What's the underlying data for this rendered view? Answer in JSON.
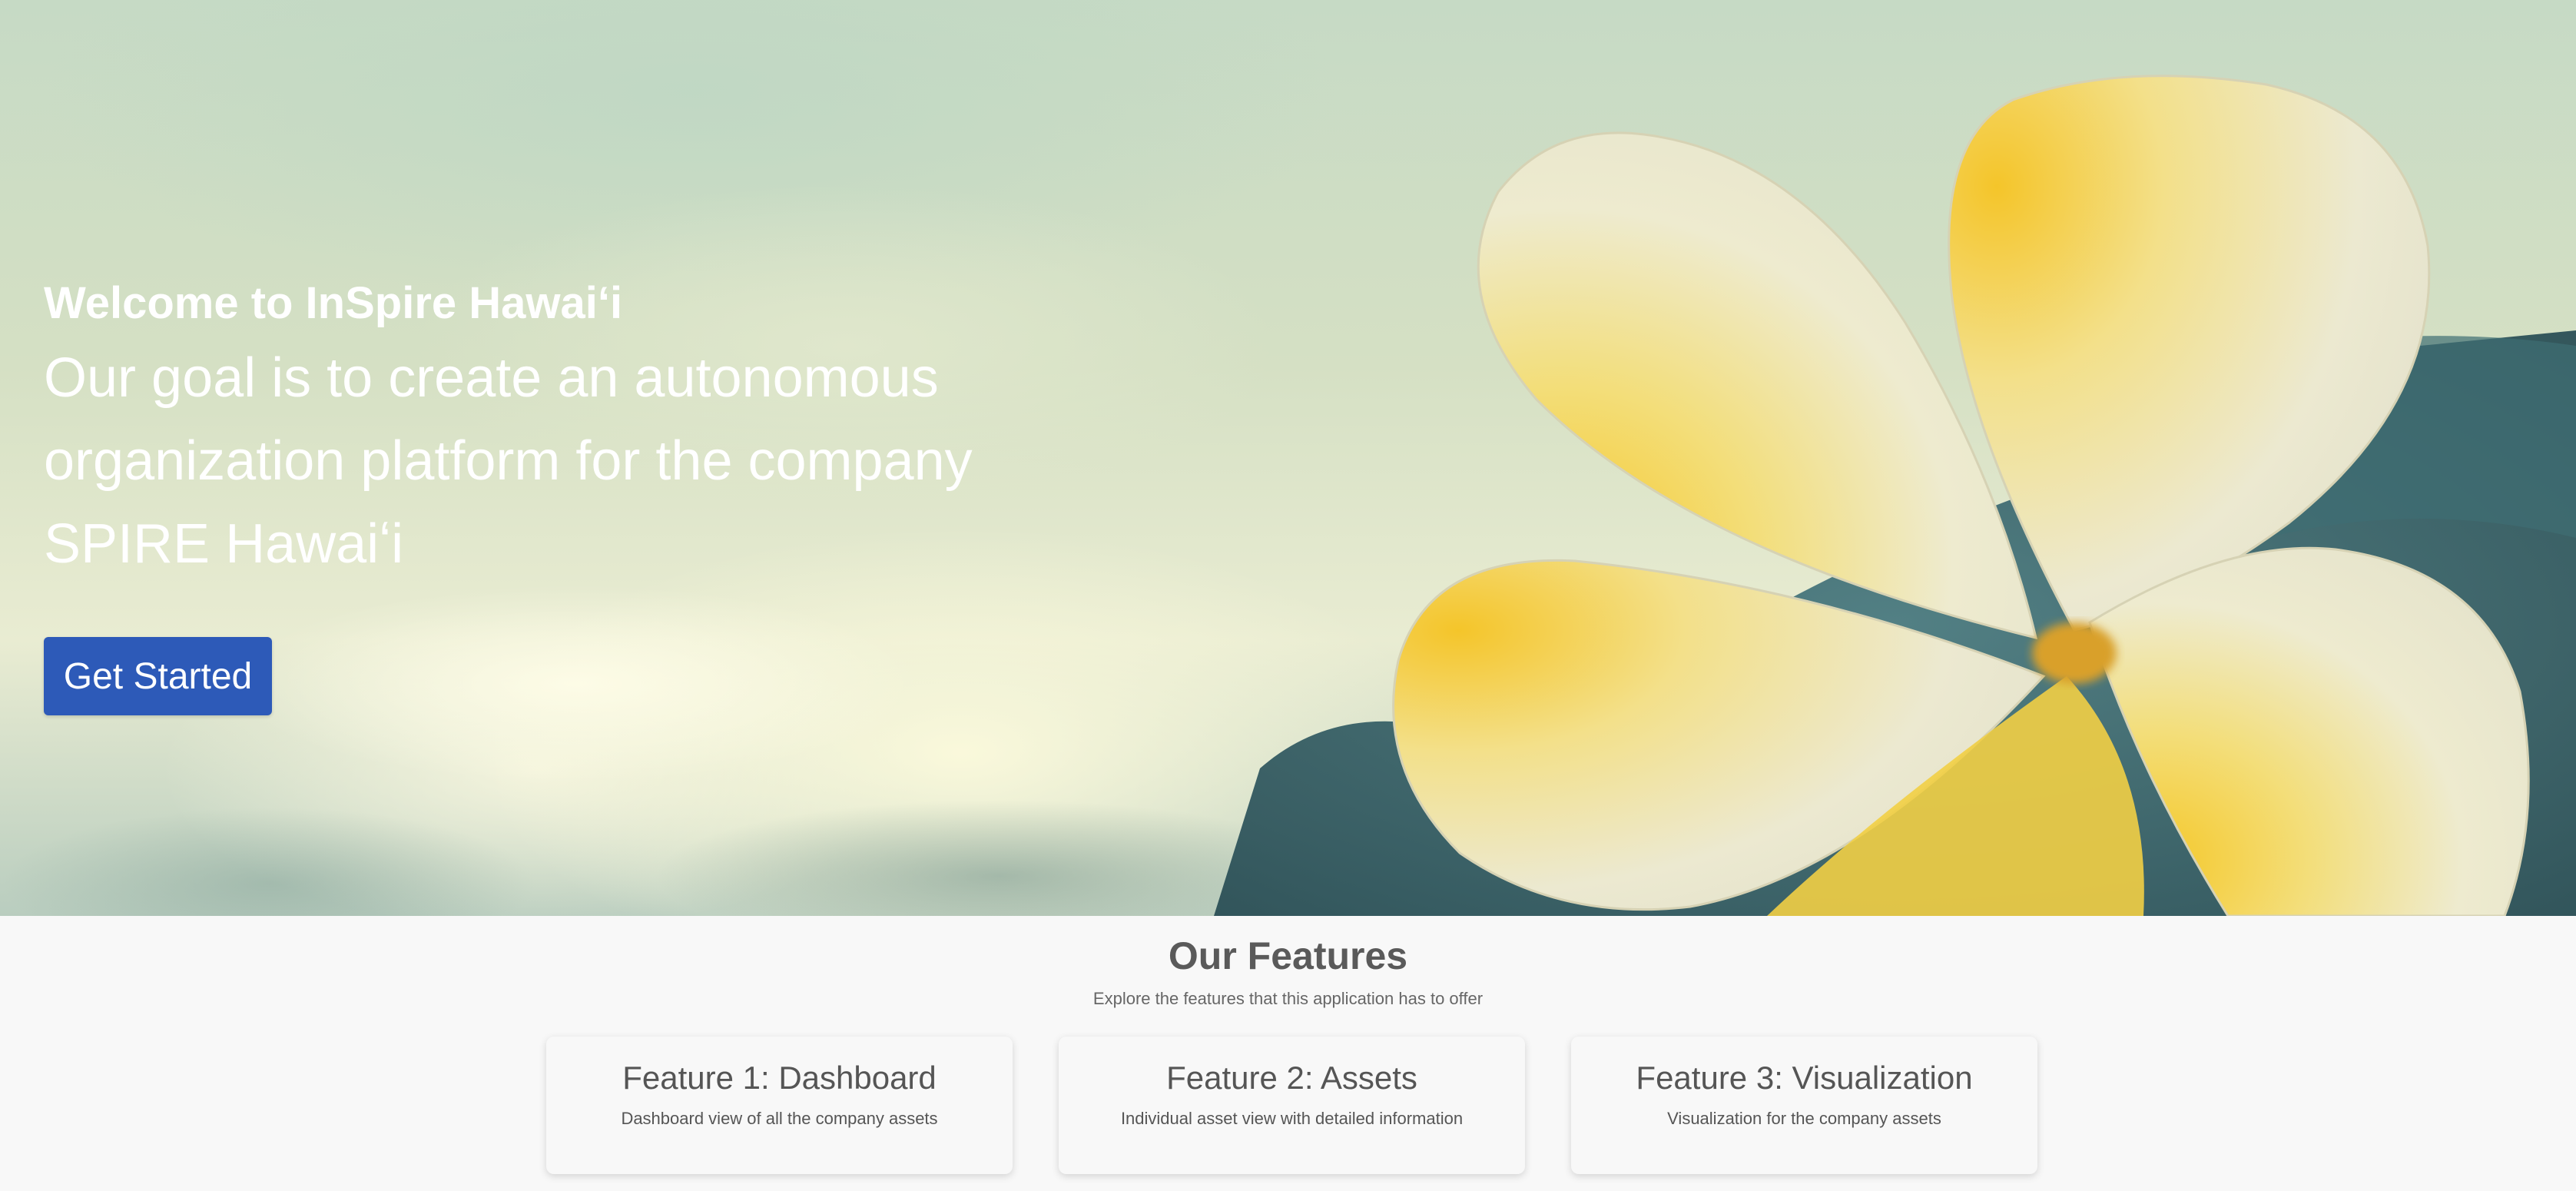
{
  "hero": {
    "title": "Welcome to InSpire Hawaiʻi",
    "goal": "Our goal is to create an autonomous organization platform for the company SPIRE Hawaiʻi",
    "cta_label": "Get Started",
    "cta_color": "#2d5ab8"
  },
  "features": {
    "title": "Our Features",
    "subtitle": "Explore the features that this application has to offer",
    "cards": [
      {
        "title": "Feature 1: Dashboard",
        "description": "Dashboard view of all the company assets"
      },
      {
        "title": "Feature 2: Assets",
        "description": "Individual asset view with detailed information"
      },
      {
        "title": "Feature 3: Visualization",
        "description": "Visualization for the company assets"
      }
    ]
  }
}
